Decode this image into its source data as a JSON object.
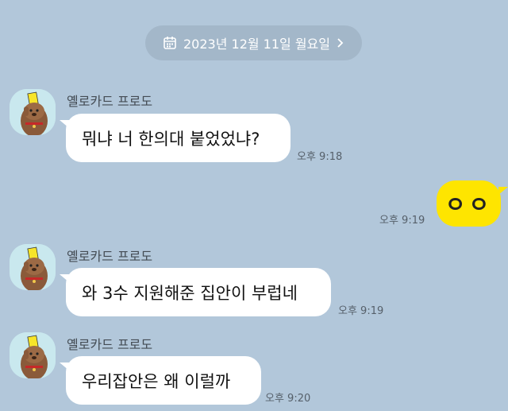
{
  "date_separator": {
    "label": "2023년 12월 11일 월요일",
    "icon": "calendar-icon",
    "chevron": "chevron-right-icon"
  },
  "messages": [
    {
      "sender": "옐로카드 프로도",
      "text": "뭐냐 너 한의대 붙었었냐?",
      "time": "오후 9:18"
    },
    {
      "mine": true,
      "text": "ㅇㅇ",
      "time": "오후 9:19"
    },
    {
      "sender": "옐로카드 프로도",
      "text": "와 3수 지원해준 집안이 부럽네",
      "time": "오후 9:19"
    },
    {
      "sender": "옐로카드 프로도",
      "text": "우리잡안은 왜 이럴까",
      "time": "오후 9:20"
    }
  ],
  "colors": {
    "background": "#b2c7da",
    "my_bubble": "#fee500",
    "their_bubble": "#ffffff",
    "date_pill": "#a3b7c9"
  }
}
